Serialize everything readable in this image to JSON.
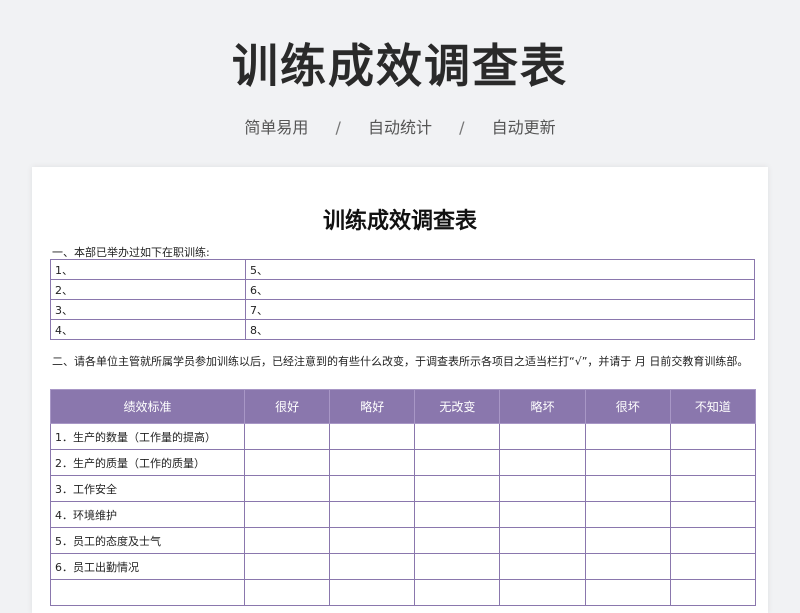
{
  "hero": {
    "title": "训练成效调查表",
    "tags": [
      "简单易用",
      "自动统计",
      "自动更新"
    ],
    "separator": "/"
  },
  "doc": {
    "title": "训练成效调查表",
    "section1_text": "一、本部已举办过如下在职训练:",
    "training_rows": [
      [
        "1、",
        "5、"
      ],
      [
        "2、",
        "6、"
      ],
      [
        "3、",
        "7、"
      ],
      [
        "4、",
        "8、"
      ]
    ],
    "section2_text": "二、请各单位主管就所属学员参加训练以后，已经注意到的有些什么改变，于调查表所示各项目之适当栏打“√”，并请于   月   日前交教育训练部。",
    "survey_headers": [
      "绩效标准",
      "很好",
      "略好",
      "无改变",
      "略坏",
      "很坏",
      "不知道"
    ],
    "survey_rows": [
      "1．生产的数量（工作量的提高）",
      "2．生产的质量（工作的质量）",
      "3．工作安全",
      "4．环境维护",
      "5．员工的态度及士气",
      "6．员工出勤情况",
      ""
    ]
  },
  "colors": {
    "accent": "#8a77ad",
    "background": "#f1f2f4"
  }
}
